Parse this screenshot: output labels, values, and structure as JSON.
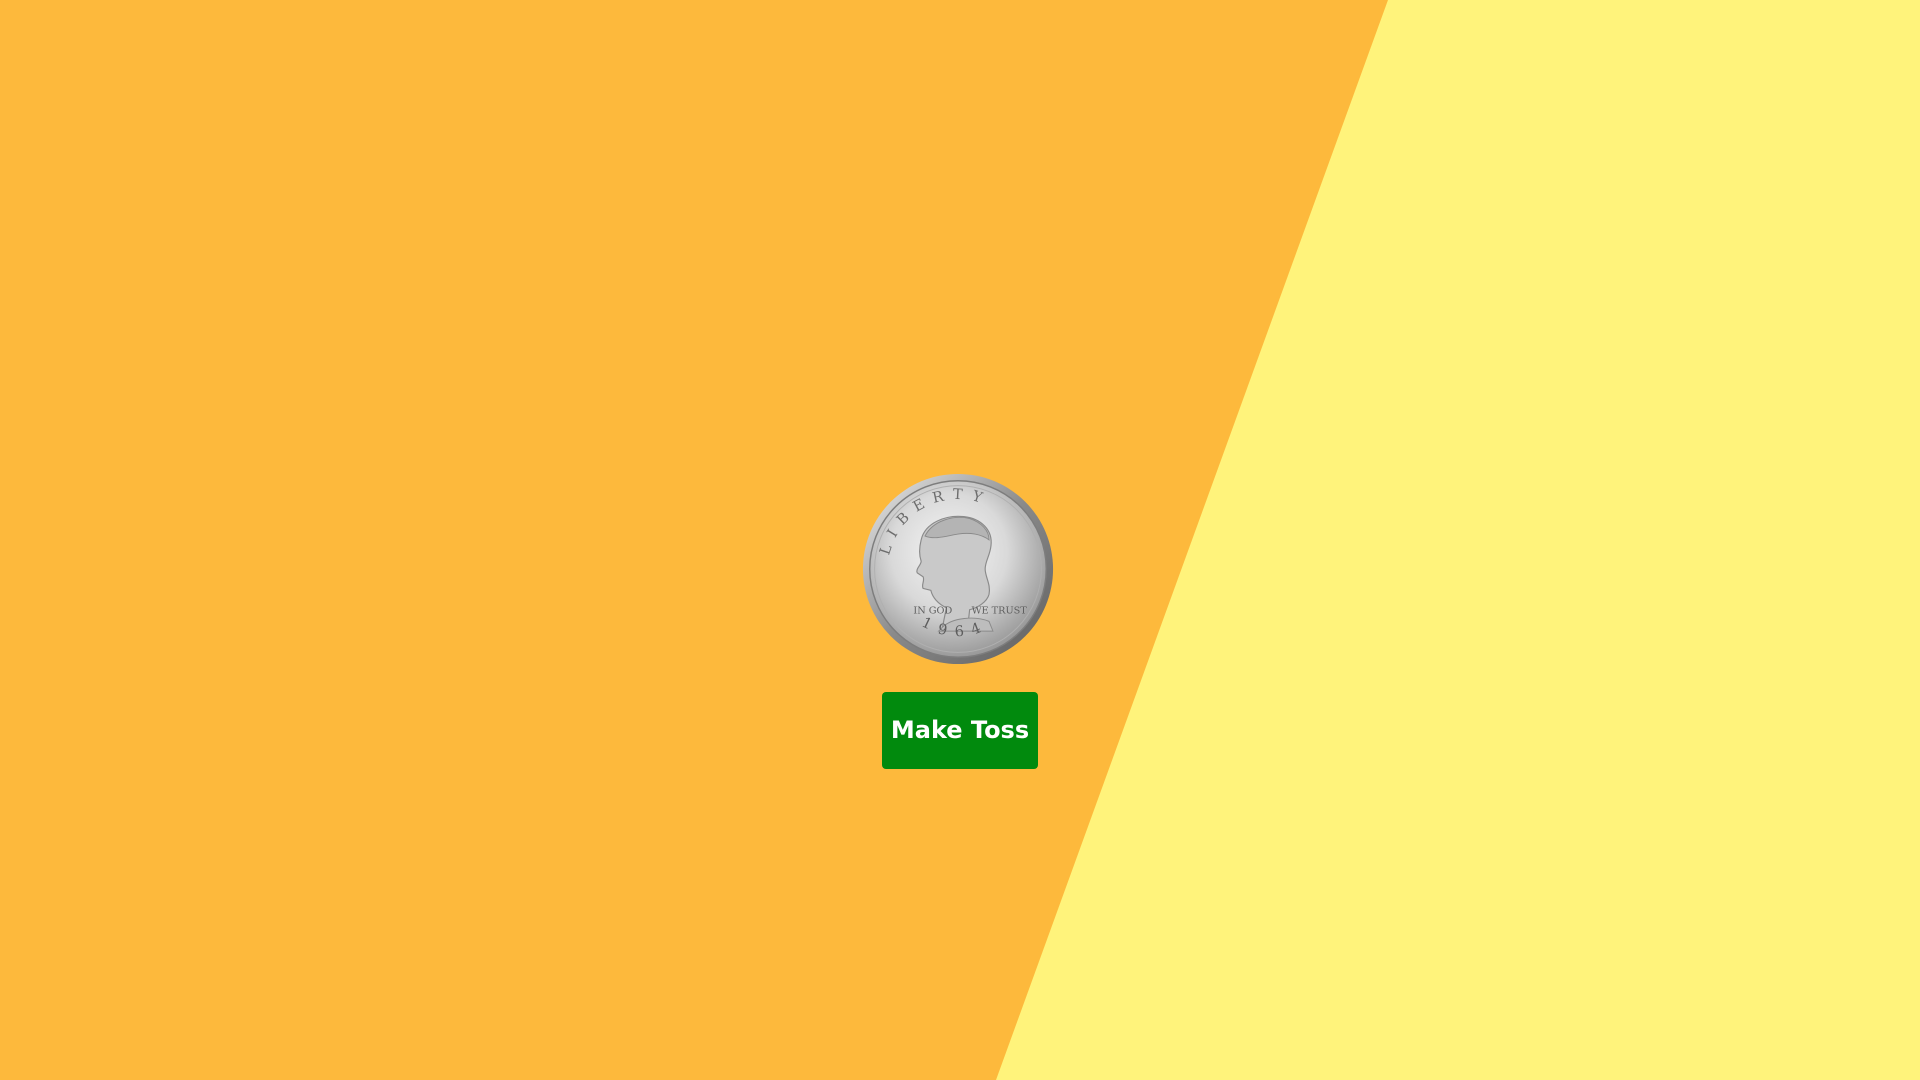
{
  "background": {
    "left_color": "#fdb93c",
    "right_color": "#fff37b"
  },
  "coin": {
    "icon": "half-dollar-coin-icon",
    "rim_text": "LIBERTY",
    "motto_left": "IN GOD",
    "motto_right": "WE TRUST",
    "year": "1964"
  },
  "toss_button": {
    "label": "Make Toss",
    "color": "#018a0d"
  }
}
